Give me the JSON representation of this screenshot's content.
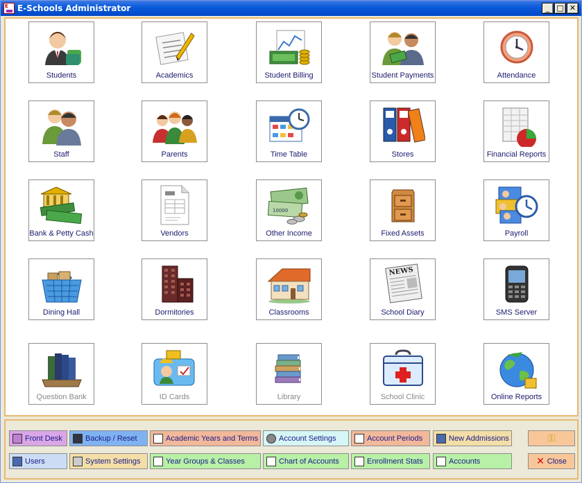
{
  "window": {
    "title": "E-Schools Administrator",
    "icon_text": "E",
    "controls": {
      "minimize": "_",
      "maximize": "□",
      "close": "✕"
    }
  },
  "tiles": [
    {
      "label": "Students",
      "icon": "students-icon"
    },
    {
      "label": "Academics",
      "icon": "academics-icon"
    },
    {
      "label": "Student Billing",
      "icon": "student-billing-icon"
    },
    {
      "label": "Student Payments",
      "icon": "student-payments-icon"
    },
    {
      "label": "Attendance",
      "icon": "attendance-icon"
    },
    {
      "label": "Staff",
      "icon": "staff-icon"
    },
    {
      "label": "Parents",
      "icon": "parents-icon"
    },
    {
      "label": "Time Table",
      "icon": "time-table-icon"
    },
    {
      "label": "Stores",
      "icon": "stores-icon"
    },
    {
      "label": "Financial Reports",
      "icon": "financial-reports-icon"
    },
    {
      "label": "Bank & Petty Cash",
      "icon": "bank-petty-cash-icon"
    },
    {
      "label": "Vendors",
      "icon": "vendors-icon"
    },
    {
      "label": "Other Income",
      "icon": "other-income-icon"
    },
    {
      "label": "Fixed Assets",
      "icon": "fixed-assets-icon"
    },
    {
      "label": "Payroll",
      "icon": "payroll-icon"
    },
    {
      "label": "Dining Hall",
      "icon": "dining-hall-icon"
    },
    {
      "label": "Dormitories",
      "icon": "dormitories-icon"
    },
    {
      "label": "Classrooms",
      "icon": "classrooms-icon"
    },
    {
      "label": "School Diary",
      "icon": "school-diary-icon"
    },
    {
      "label": "SMS Server",
      "icon": "sms-server-icon"
    },
    {
      "label": "Question Bank",
      "icon": "question-bank-icon",
      "disabled": true
    },
    {
      "label": "ID Cards",
      "icon": "id-cards-icon",
      "disabled": true
    },
    {
      "label": "Library",
      "icon": "library-icon",
      "disabled": true
    },
    {
      "label": "School Clinic",
      "icon": "school-clinic-icon",
      "disabled": true
    },
    {
      "label": "Online Reports",
      "icon": "online-reports-icon"
    }
  ],
  "quick_buttons": {
    "front_desk": "Front Desk",
    "backup_reset": "Backup / Reset",
    "academic_years": "Academic Years and Terms",
    "account_settings": "Account Settings",
    "account_periods": "Account Periods",
    "new_admissions": "New Addmissions",
    "users": "Users",
    "system_settings": "System Settings",
    "year_groups": "Year Groups & Classes",
    "chart_of_accounts": "Chart of Accounts",
    "enrollment_stats": "Enrollment Stats",
    "accounts": "Accounts",
    "close": "Close"
  },
  "colors": {
    "title_bar": "#0A5BDC",
    "panel_border": "#E8B870",
    "purple_btn": "#D9A6E6",
    "blue_btn": "#7FB2F0",
    "salmon_btn": "#F2B89A",
    "cyan_btn": "#D6F5F5",
    "tan_btn": "#F2DEA6",
    "green_btn": "#B8F0A6",
    "lightblue_btn": "#CCDCF5",
    "peach_btn": "#F7C79A"
  }
}
